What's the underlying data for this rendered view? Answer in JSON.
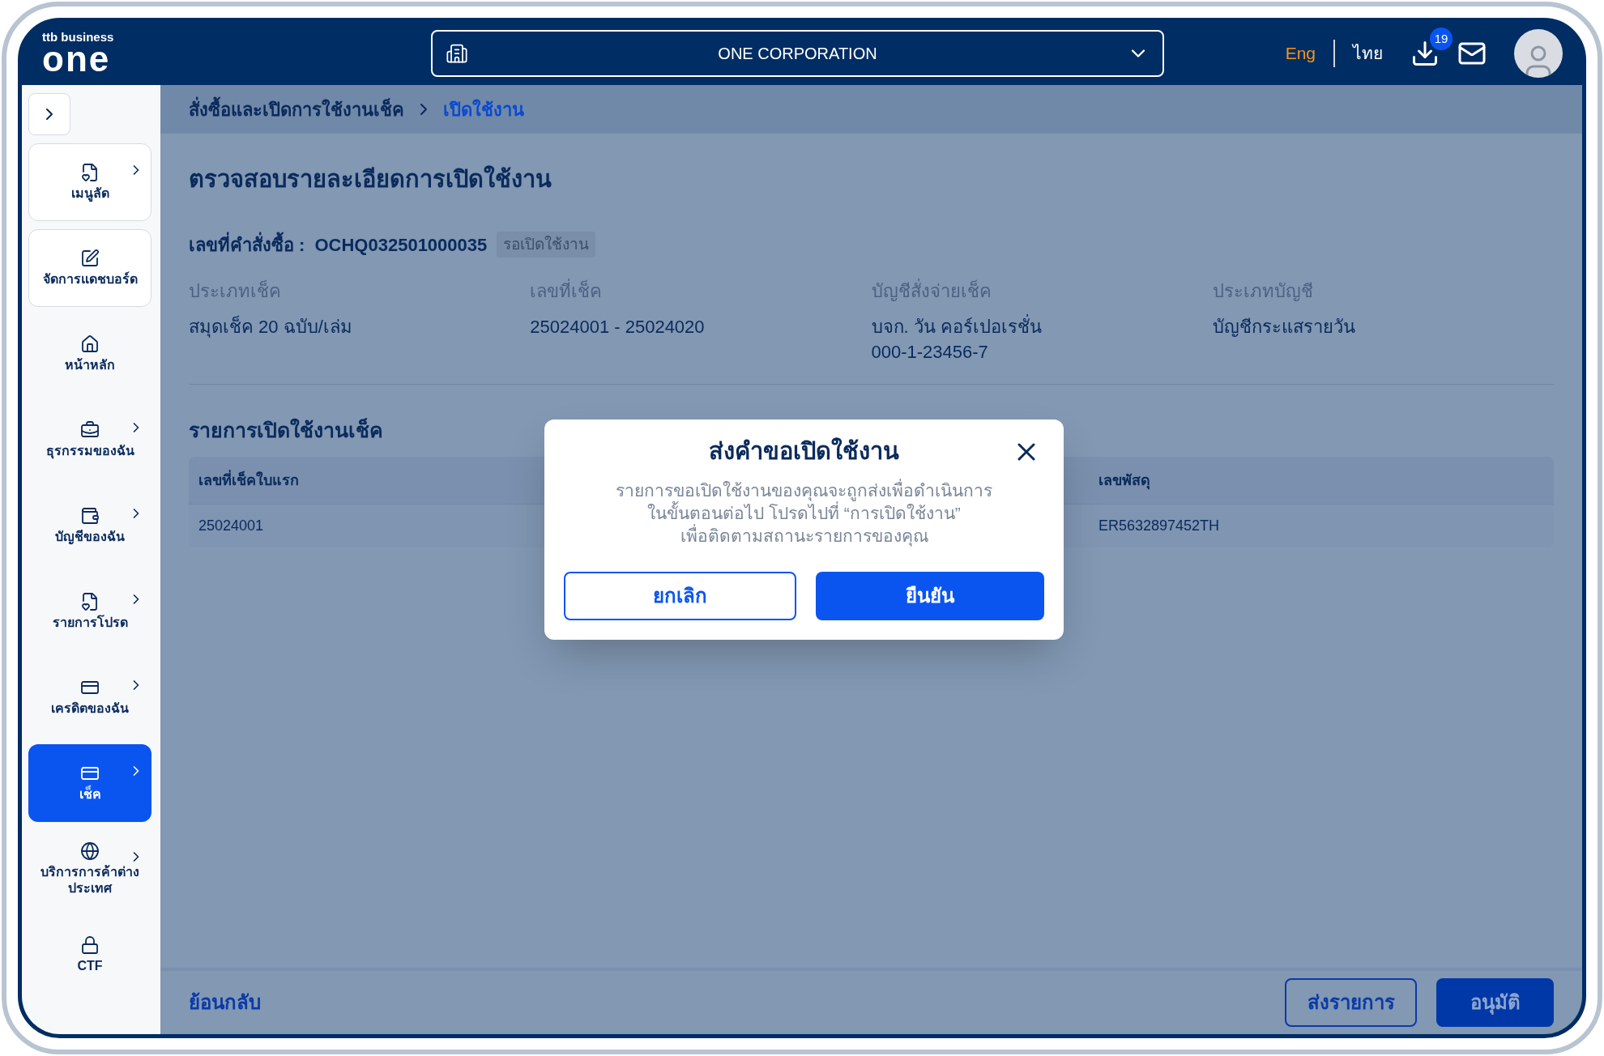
{
  "header": {
    "logo_small": "ttb business",
    "logo_big": "one",
    "company": "ONE CORPORATION",
    "languages": [
      {
        "label": "Eng",
        "selected": true
      },
      {
        "label": "ไทย",
        "selected": false
      }
    ],
    "download_badge": "19"
  },
  "sidebar": {
    "items": [
      {
        "label": "เมนูลัด",
        "kind": "card",
        "chevron": true,
        "selected": false
      },
      {
        "label": "จัดการแดชบอร์ด",
        "kind": "card",
        "chevron": false,
        "selected": false
      },
      {
        "label": "หน้าหลัก",
        "kind": "plain",
        "chevron": false,
        "selected": false
      },
      {
        "label": "ธุรกรรมของฉัน",
        "kind": "plain",
        "chevron": true,
        "selected": false
      },
      {
        "label": "บัญชีของฉัน",
        "kind": "plain",
        "chevron": true,
        "selected": false
      },
      {
        "label": "รายการโปรด",
        "kind": "plain",
        "chevron": true,
        "selected": false
      },
      {
        "label": "เครดิตของฉัน",
        "kind": "plain",
        "chevron": true,
        "selected": false
      },
      {
        "label": "เช็ค",
        "kind": "plain",
        "chevron": true,
        "selected": true
      },
      {
        "label": "บริการการค้าต่างประเทศ",
        "kind": "plain",
        "chevron": true,
        "selected": false
      },
      {
        "label": "CTF",
        "kind": "plain",
        "chevron": false,
        "selected": false
      }
    ]
  },
  "breadcrumb": [
    {
      "label": "สั่งซื้อและเปิดการใช้งานเช็ค",
      "selected": false
    },
    {
      "label": "เปิดใช้งาน",
      "selected": true
    }
  ],
  "title": "ตรวจสอบรายละเอียดการเปิดใช้งาน",
  "order": {
    "label": "เลขที่คำสั่งซื้อ :",
    "value": "OCHQ032501000035",
    "status": "รอเปิดใช้งาน"
  },
  "details": [
    {
      "label": "ประเภทเช็ค",
      "lines": [
        "สมุดเช็ค 20 ฉบับ/เล่ม"
      ]
    },
    {
      "label": "เลขที่เช็ค",
      "lines": [
        "25024001 - 25024020"
      ]
    },
    {
      "label": "บัญชีสั่งจ่ายเช็ค",
      "lines": [
        "บจก. วัน คอร์เปอเรชั่น",
        "000-1-23456-7"
      ]
    },
    {
      "label": "ประเภทบัญชี",
      "lines": [
        "บัญชีกระแสรายวัน"
      ]
    }
  ],
  "section_title": "รายการเปิดใช้งานเช็ค",
  "table": {
    "columns": [
      "เลขที่เช็คใบแรก",
      "เลขพัสดุ"
    ],
    "rows": [
      [
        "25024001",
        "ER5632897452TH"
      ]
    ]
  },
  "footer": {
    "back": "ย้อนกลับ",
    "buttons": [
      {
        "label": "ส่งรายการ",
        "kind": "outline"
      },
      {
        "label": "อนุมัติ",
        "kind": "filled"
      }
    ]
  },
  "dialog": {
    "title": "ส่งคำขอเปิดใช้งาน",
    "message_lines": [
      "รายการขอเปิดใช้งานของคุณจะถูกส่งเพื่อดำเนินการ",
      "ในขั้นตอนต่อไป โปรดไปที่ “การเปิดใช้งาน”",
      "เพื่อติดตามสถานะรายการของคุณ"
    ],
    "buttons": [
      {
        "label": "ยกเลิก",
        "kind": "outline"
      },
      {
        "label": "ยืนยัน",
        "kind": "filled"
      }
    ]
  }
}
